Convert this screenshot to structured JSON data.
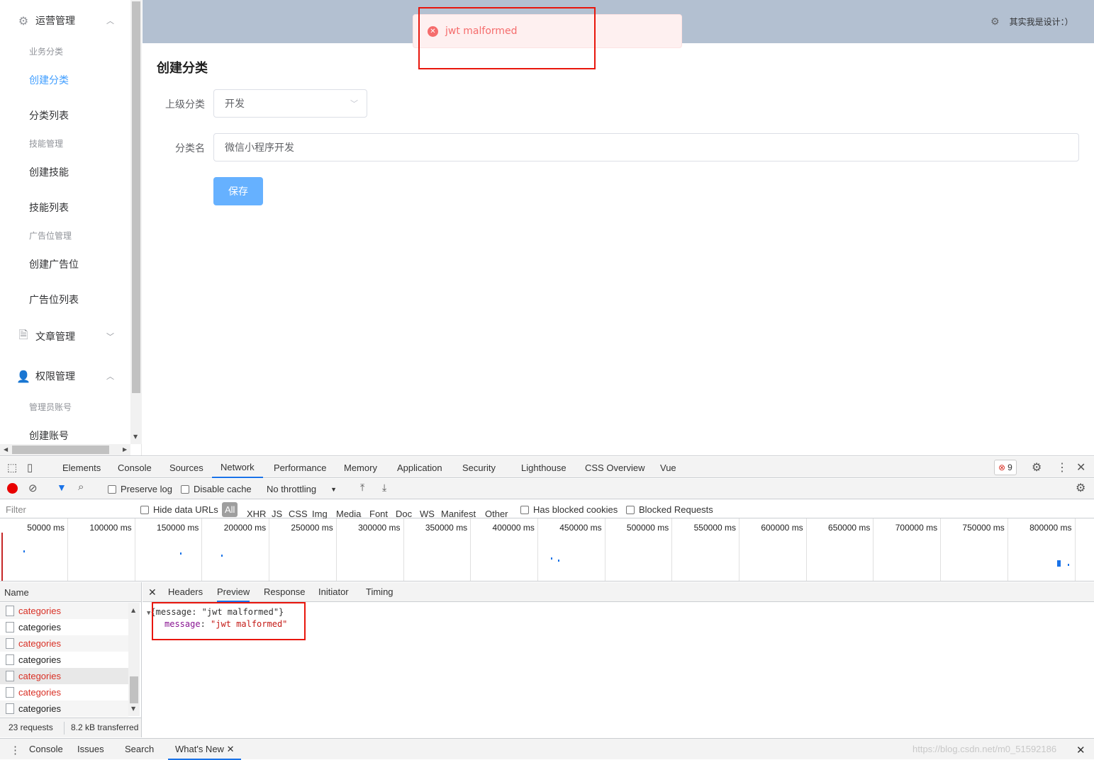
{
  "sidebar": {
    "groups": [
      {
        "label": "运营管理",
        "icon": "gear-icon"
      },
      {
        "label": "文章管理",
        "icon": "document-icon"
      },
      {
        "label": "权限管理",
        "icon": "user-icon"
      }
    ],
    "items": [
      {
        "label": "业务分类",
        "type": "header"
      },
      {
        "label": "创建分类",
        "type": "active"
      },
      {
        "label": "分类列表",
        "type": "item"
      },
      {
        "label": "技能管理",
        "type": "header"
      },
      {
        "label": "创建技能",
        "type": "item"
      },
      {
        "label": "技能列表",
        "type": "item"
      },
      {
        "label": "广告位管理",
        "type": "header"
      },
      {
        "label": "创建广告位",
        "type": "item"
      },
      {
        "label": "广告位列表",
        "type": "item"
      },
      {
        "label": "管理员账号",
        "type": "header"
      },
      {
        "label": "创建账号",
        "type": "item"
      }
    ]
  },
  "header": {
    "user_text": "其实我是设计：）"
  },
  "toast": {
    "message": "jwt malformed",
    "type": "error"
  },
  "form": {
    "title": "创建分类",
    "parent_label": "上级分类",
    "parent_value": "开发",
    "name_label": "分类名",
    "name_value": "微信小程序开发",
    "save_label": "保存"
  },
  "devtools": {
    "tabs": [
      "Elements",
      "Console",
      "Sources",
      "Network",
      "Performance",
      "Memory",
      "Application",
      "Security",
      "Lighthouse",
      "CSS Overview",
      "Vue"
    ],
    "active_tab": "Network",
    "error_count": "9",
    "toolbar": {
      "preserve_log": "Preserve log",
      "disable_cache": "Disable cache",
      "throttling": "No throttling"
    },
    "filter": {
      "placeholder": "Filter",
      "hide_data_urls": "Hide data URLs",
      "types": [
        "All",
        "XHR",
        "JS",
        "CSS",
        "Img",
        "Media",
        "Font",
        "Doc",
        "WS",
        "Manifest",
        "Other"
      ],
      "has_blocked_cookies": "Has blocked cookies",
      "blocked_requests": "Blocked Requests"
    },
    "timeline_ticks": [
      "50000 ms",
      "100000 ms",
      "150000 ms",
      "200000 ms",
      "250000 ms",
      "300000 ms",
      "350000 ms",
      "400000 ms",
      "450000 ms",
      "500000 ms",
      "550000 ms",
      "600000 ms",
      "650000 ms",
      "700000 ms",
      "750000 ms",
      "800000 ms"
    ],
    "name_header": "Name",
    "requests": [
      {
        "name": "categories",
        "error": true
      },
      {
        "name": "categories",
        "error": false
      },
      {
        "name": "categories",
        "error": true
      },
      {
        "name": "categories",
        "error": false
      },
      {
        "name": "categories",
        "error": true
      },
      {
        "name": "categories",
        "error": true
      },
      {
        "name": "categories",
        "error": false
      }
    ],
    "status": {
      "requests": "23 requests",
      "transferred": "8.2 kB transferred"
    },
    "detail_tabs": [
      "Headers",
      "Preview",
      "Response",
      "Initiator",
      "Timing"
    ],
    "preview": {
      "summary": "{message: \"jwt malformed\"}",
      "key": "message",
      "value": "\"jwt malformed\""
    },
    "drawer_tabs": [
      "Console",
      "Issues",
      "Search",
      "What's New"
    ],
    "watermark": "https://blog.csdn.net/m0_51592186"
  }
}
